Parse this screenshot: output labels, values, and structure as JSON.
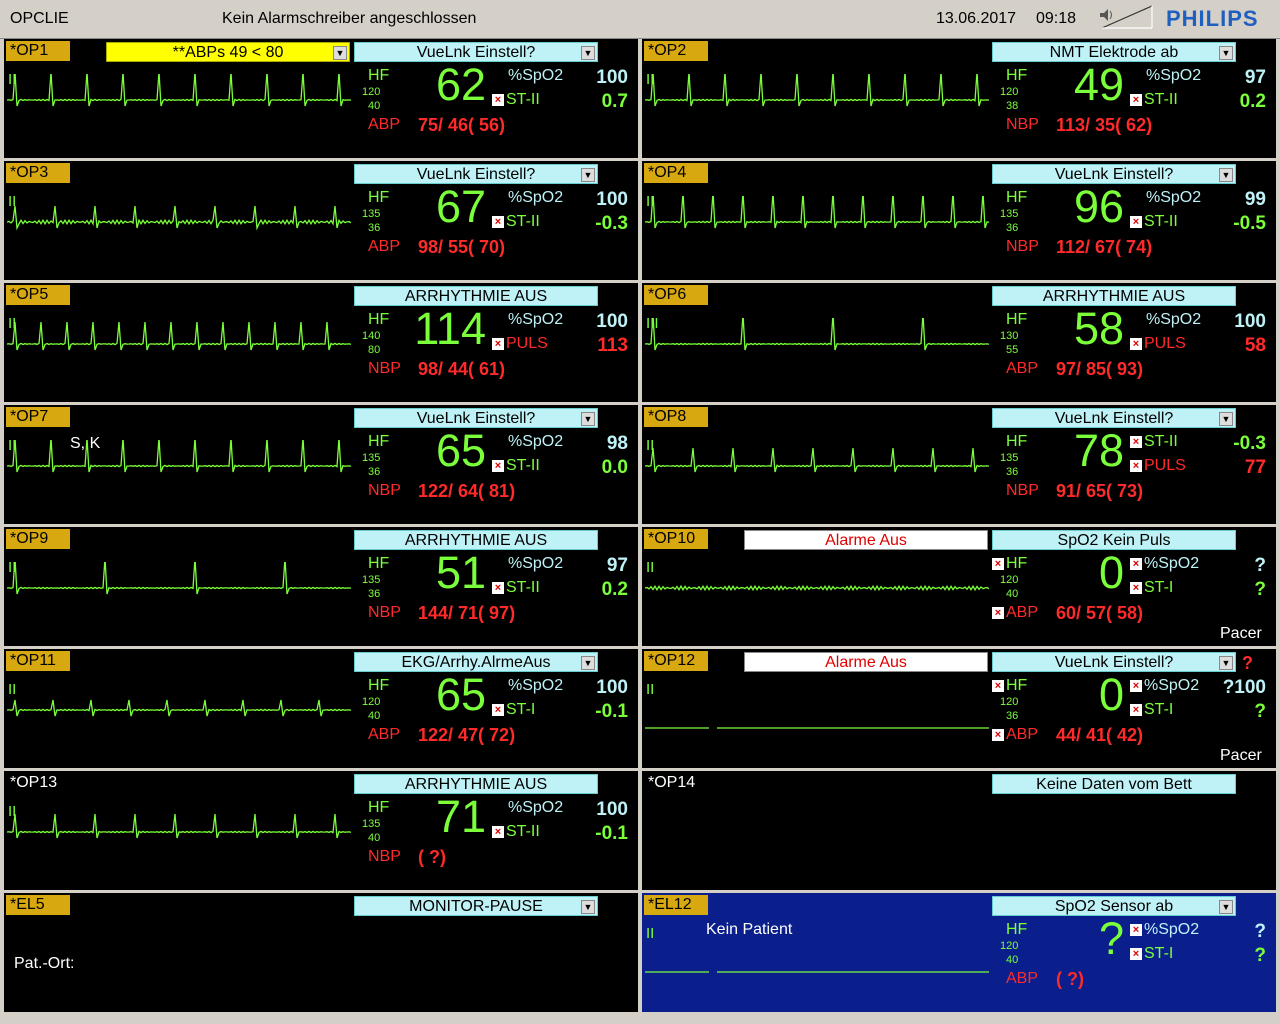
{
  "header": {
    "app": "OPCLIE",
    "message": "Kein Alarmschreiber angeschlossen",
    "date": "13.06.2017",
    "time": "09:18",
    "brand": "PHILIPS"
  },
  "icons": {
    "speaker": "speaker-volume-icon",
    "dropdown": "dropdown-arrow-icon",
    "alarm_off": "alarm-off-x-icon",
    "patient": "patient-figure-icon"
  },
  "colors": {
    "wave": "#7bff3a",
    "alarm": "#ff2a2a",
    "spo2": "#bff2f7",
    "label_bed": "#d8a811",
    "blue_tile": "#0a1f8c"
  },
  "beds": [
    {
      "id": "*OP1",
      "lead": "II",
      "status": "VueLnk Einstell?",
      "alarm_box": "**ABPs 49 < 80",
      "hf": "62",
      "hf_hi": "120",
      "hf_lo": "40",
      "p1_label": "%SpO2",
      "p1_val": "100",
      "p2_label": "ST-II",
      "p2_val": "0.7",
      "bp_label": "ABP",
      "bp_val": "75/ 46( 56)"
    },
    {
      "id": "*OP2",
      "lead": "II",
      "status": "NMT Elektrode ab",
      "hf": "49",
      "hf_hi": "120",
      "hf_lo": "38",
      "p1_label": "%SpO2",
      "p1_val": "97",
      "p2_label": "ST-II",
      "p2_val": "0.2",
      "bp_label": "NBP",
      "bp_val": "113/ 35( 62)"
    },
    {
      "id": "*OP3",
      "lead": "II",
      "status": "VueLnk Einstell?",
      "hf": "67",
      "hf_hi": "135",
      "hf_lo": "36",
      "p1_label": "%SpO2",
      "p1_val": "100",
      "p2_label": "ST-II",
      "p2_val": "-0.3",
      "bp_label": "ABP",
      "bp_val": "98/ 55( 70)"
    },
    {
      "id": "*OP4",
      "lead": "II",
      "status": "VueLnk Einstell?",
      "hf": "96",
      "hf_hi": "135",
      "hf_lo": "36",
      "p1_label": "%SpO2",
      "p1_val": "99",
      "p2_label": "ST-II",
      "p2_val": "-0.5",
      "bp_label": "NBP",
      "bp_val": "112/ 67( 74)"
    },
    {
      "id": "*OP5",
      "lead": "II",
      "status": "ARRHYTHMIE AUS",
      "hf": "114",
      "hf_hi": "140",
      "hf_lo": "80",
      "p1_label": "%SpO2",
      "p1_val": "100",
      "p2_label": "PULS",
      "p2_val": "113",
      "bp_label": "NBP",
      "bp_val": "98/ 44( 61)"
    },
    {
      "id": "*OP6",
      "lead": "III",
      "status": "ARRHYTHMIE AUS",
      "hf": "58",
      "hf_hi": "130",
      "hf_lo": "55",
      "p1_label": "%SpO2",
      "p1_val": "100",
      "p2_label": "PULS",
      "p2_val": "58",
      "bp_label": "ABP",
      "bp_val": "97/ 85( 93)"
    },
    {
      "id": "*OP7",
      "lead": "II",
      "extra": "S, K",
      "status": "VueLnk Einstell?",
      "hf": "65",
      "hf_hi": "135",
      "hf_lo": "36",
      "p1_label": "%SpO2",
      "p1_val": "98",
      "p2_label": "ST-II",
      "p2_val": "0.0",
      "bp_label": "NBP",
      "bp_val": "122/ 64( 81)"
    },
    {
      "id": "*OP8",
      "lead": "II",
      "status": "VueLnk Einstell?",
      "hf": "78",
      "hf_hi": "135",
      "hf_lo": "36",
      "p1_label": "ST-II",
      "p1_val": "-0.3",
      "p2_label": "PULS",
      "p2_val": "77",
      "bp_label": "NBP",
      "bp_val": "91/ 65( 73)"
    },
    {
      "id": "*OP9",
      "lead": "II",
      "status": "ARRHYTHMIE AUS",
      "hf": "51",
      "hf_hi": "135",
      "hf_lo": "36",
      "p1_label": "%SpO2",
      "p1_val": "97",
      "p2_label": "ST-II",
      "p2_val": "0.2",
      "bp_label": "NBP",
      "bp_val": "144/ 71( 97)"
    },
    {
      "id": "*OP10",
      "lead": "II",
      "status": "SpO2   Kein Puls",
      "alarm_box": "Alarme Aus",
      "hf": "0",
      "hf_hi": "120",
      "hf_lo": "40",
      "p1_label": "%SpO2",
      "p1_val": "?",
      "p2_label": "ST-I",
      "p2_val": "?",
      "bp_label": "ABP",
      "bp_val": "60/ 57( 58)",
      "pacer": "Pacer"
    },
    {
      "id": "*OP11",
      "lead": "II",
      "status": "EKG/Arrhy.AlrmeAus",
      "hf": "65",
      "hf_hi": "120",
      "hf_lo": "40",
      "p1_label": "%SpO2",
      "p1_val": "100",
      "p2_label": "ST-I",
      "p2_val": "-0.1",
      "bp_label": "ABP",
      "bp_val": "122/ 47( 72)"
    },
    {
      "id": "*OP12",
      "lead": "II",
      "status": "VueLnk Einstell?",
      "alarm_box": "Alarme Aus",
      "hf": "0",
      "hf_hi": "120",
      "hf_lo": "36",
      "p1_label": "%SpO2",
      "p1_val": "?100",
      "p2_label": "ST-I",
      "p2_val": "?",
      "bp_label": "ABP",
      "bp_val": "44/ 41( 42)",
      "pacer": "Pacer",
      "qmark": "?"
    },
    {
      "id": "*OP13",
      "lead": "II",
      "status": "ARRHYTHMIE AUS",
      "hf": "71",
      "hf_hi": "135",
      "hf_lo": "40",
      "p1_label": "%SpO2",
      "p1_val": "100",
      "p2_label": "ST-II",
      "p2_val": "-0.1",
      "bp_label": "NBP",
      "bp_val": "(  ?)"
    },
    {
      "id": "*OP14",
      "status": "Keine Daten vom Bett"
    },
    {
      "id": "*EL5",
      "status": "MONITOR-PAUSE",
      "note": "Pat.-Ort:"
    },
    {
      "id": "*EL12",
      "lead": "II",
      "status": "SpO2   Sensor ab",
      "note": "Kein Patient",
      "hf": "?",
      "hf_hi": "120",
      "hf_lo": "40",
      "p1_label": "%SpO2",
      "p1_val": "?",
      "p2_label": "ST-I",
      "p2_val": "?",
      "bp_label": "ABP",
      "bp_val": "(  ?)"
    }
  ]
}
